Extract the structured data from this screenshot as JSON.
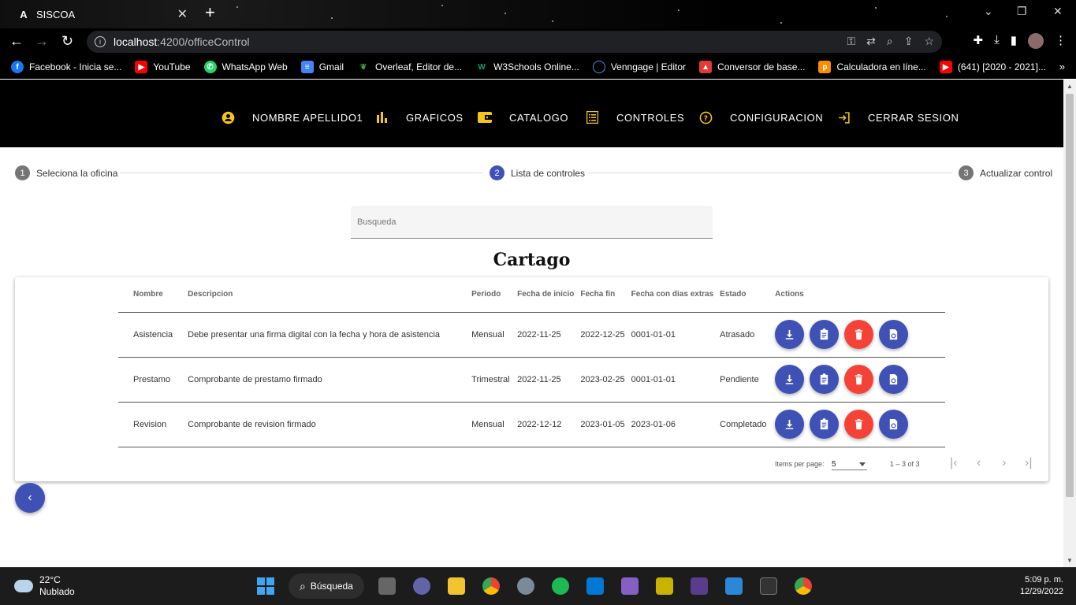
{
  "browser": {
    "tab_title": "SISCOA",
    "tab_favicon": "A",
    "url_host": "localhost",
    "url_rest": ":4200/officeControl",
    "bookmarks": [
      {
        "label": "Facebook - Inicia se...",
        "icon": "facebook-icon",
        "color": "#1877f2"
      },
      {
        "label": "YouTube",
        "icon": "youtube-icon",
        "color": "#ff0000"
      },
      {
        "label": "WhatsApp Web",
        "icon": "whatsapp-icon",
        "color": "#25d366"
      },
      {
        "label": "Gmail",
        "icon": "gmail-icon",
        "color": "#4285f4"
      },
      {
        "label": "Overleaf, Editor de...",
        "icon": "overleaf-icon",
        "color": "#47a141"
      },
      {
        "label": "W3Schools Online...",
        "icon": "w3schools-icon",
        "color": "#04aa6d"
      },
      {
        "label": "Venngage | Editor",
        "icon": "venngage-icon",
        "color": "#4a90e2"
      },
      {
        "label": "Conversor de base...",
        "icon": "converter-icon",
        "color": "#e53935"
      },
      {
        "label": "Calculadora en líne...",
        "icon": "calculator-icon",
        "color": "#fb8c00"
      },
      {
        "label": "(641) [2020 - 2021]...",
        "icon": "youtube-icon",
        "color": "#ff0000"
      }
    ]
  },
  "header": {
    "user": "NOMBRE APELLIDO1",
    "graficos": "GRAFICOS",
    "catalogo": "CATALOGO",
    "controles": "CONTROLES",
    "configuracion": "CONFIGURACION",
    "logout": "CERRAR SESION",
    "accent": "#f5c518"
  },
  "stepper": {
    "step1": {
      "num": "1",
      "label": "Seleciona la oficina"
    },
    "step2": {
      "num": "2",
      "label": "Lista de controles"
    },
    "step3": {
      "num": "3",
      "label": "Actualizar control"
    }
  },
  "search": {
    "placeholder": "Busqueda"
  },
  "office": {
    "title": "Cartago"
  },
  "table": {
    "headers": [
      "Nombre",
      "Descripcion",
      "Periodo",
      "Fecha de inicio",
      "Fecha fin",
      "Fecha con dias extras",
      "Estado",
      "Actions"
    ],
    "rows": [
      [
        "Asistencia",
        "Debe presentar una firma digital con la fecha y hora de asistencia",
        "Mensual",
        "2022-11-25",
        "2022-12-25",
        "0001-01-01",
        "Atrasado"
      ],
      [
        "Prestamo",
        "Comprobante de prestamo firmado",
        "Trimestral",
        "2022-11-25",
        "2023-02-25",
        "0001-01-01",
        "Pendiente"
      ],
      [
        "Revision",
        "Comprobante de revision firmado",
        "Mensual",
        "2022-12-12",
        "2023-01-05",
        "2023-01-06",
        "Completado"
      ]
    ]
  },
  "paginator": {
    "label": "Items per page:",
    "page_size": "5",
    "range": "1 – 3 of 3"
  },
  "colors": {
    "primary": "#3f51b5",
    "danger": "#f44336"
  },
  "taskbar": {
    "temp": "22°C",
    "weather": "Nublado",
    "search": "Búsqueda",
    "time": "5:09 p. m.",
    "date": "12/29/2022"
  }
}
